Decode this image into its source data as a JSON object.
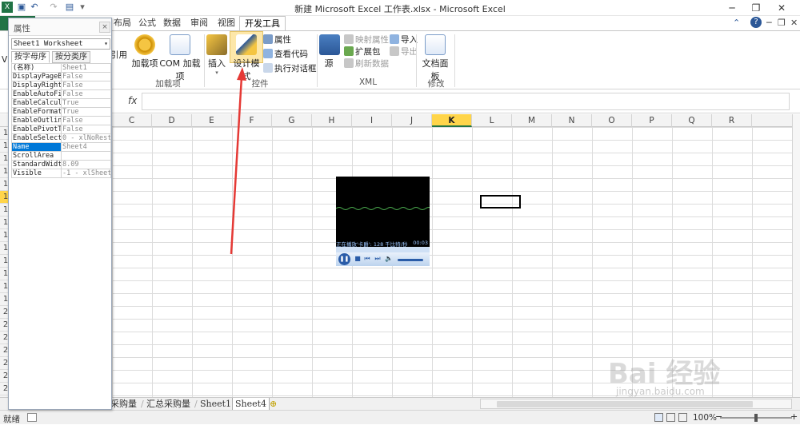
{
  "window": {
    "title": "新建 Microsoft Excel 工作表.xlsx - Microsoft Excel",
    "minimize": "─",
    "restore": "❐",
    "close": "✕"
  },
  "ribbon_tabs": [
    {
      "label": "布局"
    },
    {
      "label": "公式"
    },
    {
      "label": "数据"
    },
    {
      "label": "审阅"
    },
    {
      "label": "视图"
    },
    {
      "label": "开发工具"
    }
  ],
  "ribbon": {
    "left_cut": {
      "vi": "Vi",
      "ref": "引用"
    },
    "addins": {
      "addin_label": "加载项",
      "com_label": "COM 加载项",
      "group": "加载项"
    },
    "controls": {
      "insert": "插入",
      "design_mode": "设计模式",
      "properties": "属性",
      "view_code": "查看代码",
      "run_dialog": "执行对话框",
      "group": "控件"
    },
    "xml": {
      "source": "源",
      "map_props": "映射属性",
      "expansion": "扩展包",
      "refresh": "刷新数据",
      "import": "导入",
      "export": "导出",
      "group": "XML"
    },
    "modify": {
      "doc_panel": "文档面板",
      "group": "修改"
    }
  },
  "formula": {
    "fx": "fx"
  },
  "columns": [
    "C",
    "D",
    "E",
    "F",
    "G",
    "H",
    "I",
    "J",
    "K",
    "L",
    "M",
    "N",
    "O",
    "P",
    "Q",
    "R"
  ],
  "selected_column": "K",
  "rows": [
    "1",
    "1",
    "1",
    "1",
    "1",
    "1",
    "1",
    "1",
    "1",
    "1",
    "1",
    "1",
    "1",
    "1",
    "2",
    "2",
    "2",
    "2",
    "2",
    "2",
    "2"
  ],
  "player": {
    "status": "正在播放'卡爵': 128 千比特/秒",
    "time": "00:03",
    "play": "❚❚",
    "stop": "■",
    "prev": "⏮",
    "next": "⏭",
    "volume": "🔈"
  },
  "properties": {
    "title": "属性",
    "close": "×",
    "object": "Sheet1 Worksheet",
    "tabs": [
      {
        "label": "按字母序"
      },
      {
        "label": "按分类序"
      }
    ],
    "rows": [
      {
        "k": "(名称)",
        "v": "Sheet1"
      },
      {
        "k": "DisplayPageBr",
        "v": "False"
      },
      {
        "k": "DisplayRightT",
        "v": "False"
      },
      {
        "k": "EnableAutoFil",
        "v": "False"
      },
      {
        "k": "EnableCalcula",
        "v": "True"
      },
      {
        "k": "EnableFormatC",
        "v": "True"
      },
      {
        "k": "EnableOutlini",
        "v": "False"
      },
      {
        "k": "EnablePivotTa",
        "v": "False"
      },
      {
        "k": "EnableSelecti",
        "v": "0 - xlNoRest"
      },
      {
        "k": "Name",
        "v": "Sheet4"
      },
      {
        "k": "ScrollArea",
        "v": ""
      },
      {
        "k": "StandardWidth",
        "v": "8.09"
      },
      {
        "k": "Visible",
        "v": "-1 - xlSheet"
      }
    ]
  },
  "sheet_tabs": [
    {
      "label": "采购量"
    },
    {
      "label": "汇总采购量"
    },
    {
      "label": "Sheet1"
    },
    {
      "label": "Sheet4"
    }
  ],
  "status": {
    "ready": "就绪",
    "zoom": "100%",
    "minus": "−",
    "plus": "+"
  },
  "watermark": {
    "brand": "Bai 经验",
    "url": "jingyan.baidu.com"
  },
  "colors": {
    "accent": "#217346",
    "selected": "#ffd54a",
    "arrow": "#e53935"
  }
}
